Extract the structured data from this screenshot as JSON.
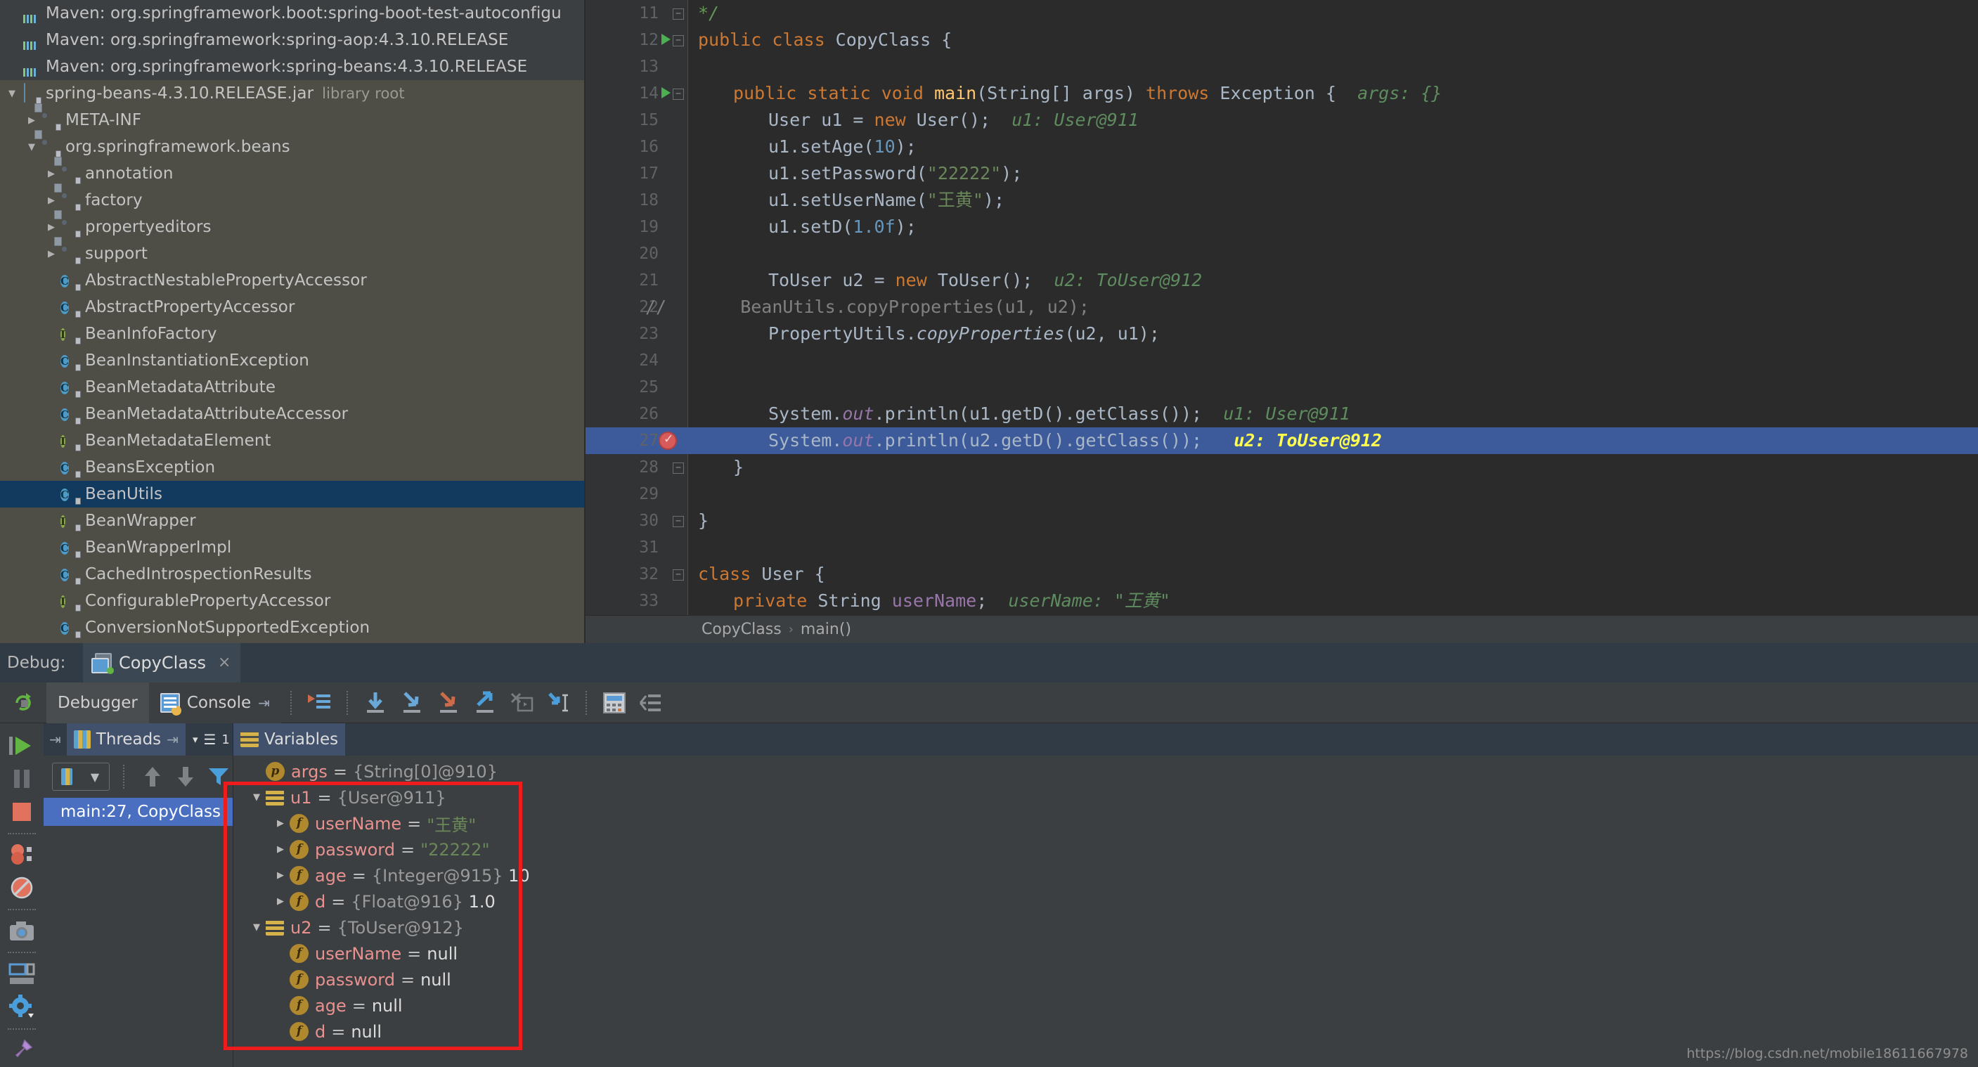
{
  "project_tree": {
    "items": [
      {
        "label": "Maven: org.springframework.boot:spring-boot-test-autoconfigu",
        "icon": "maven-icon",
        "indent": 0,
        "arrow": "none",
        "style": "maven"
      },
      {
        "label": "Maven: org.springframework:spring-aop:4.3.10.RELEASE",
        "icon": "maven-icon",
        "indent": 0,
        "arrow": "none",
        "style": "maven"
      },
      {
        "label": "Maven: org.springframework:spring-beans:4.3.10.RELEASE",
        "icon": "maven-icon",
        "indent": 0,
        "arrow": "none",
        "style": "maven"
      },
      {
        "label": "spring-beans-4.3.10.RELEASE.jar",
        "sub": "library root",
        "icon": "jar-icon",
        "indent": 0,
        "arrow": "down",
        "style": "normal"
      },
      {
        "label": "META-INF",
        "icon": "package-icon",
        "indent": 1,
        "arrow": "right",
        "style": "normal"
      },
      {
        "label": "org.springframework.beans",
        "icon": "package-icon",
        "indent": 1,
        "arrow": "down",
        "style": "normal"
      },
      {
        "label": "annotation",
        "icon": "package-icon",
        "indent": 2,
        "arrow": "right",
        "style": "normal"
      },
      {
        "label": "factory",
        "icon": "package-icon",
        "indent": 2,
        "arrow": "right",
        "style": "normal"
      },
      {
        "label": "propertyeditors",
        "icon": "package-icon",
        "indent": 2,
        "arrow": "right",
        "style": "normal"
      },
      {
        "label": "support",
        "icon": "package-icon",
        "indent": 2,
        "arrow": "right",
        "style": "normal"
      },
      {
        "label": "AbstractNestablePropertyAccessor",
        "icon": "class-icon",
        "indent": 2,
        "arrow": "none",
        "style": "normal"
      },
      {
        "label": "AbstractPropertyAccessor",
        "icon": "class-icon",
        "indent": 2,
        "arrow": "none",
        "style": "normal"
      },
      {
        "label": "BeanInfoFactory",
        "icon": "interface-icon",
        "indent": 2,
        "arrow": "none",
        "style": "normal"
      },
      {
        "label": "BeanInstantiationException",
        "icon": "class-icon",
        "indent": 2,
        "arrow": "none",
        "style": "normal"
      },
      {
        "label": "BeanMetadataAttribute",
        "icon": "class-icon",
        "indent": 2,
        "arrow": "none",
        "style": "normal"
      },
      {
        "label": "BeanMetadataAttributeAccessor",
        "icon": "class-icon",
        "indent": 2,
        "arrow": "none",
        "style": "normal"
      },
      {
        "label": "BeanMetadataElement",
        "icon": "interface-icon",
        "indent": 2,
        "arrow": "none",
        "style": "normal"
      },
      {
        "label": "BeansException",
        "icon": "class-icon",
        "indent": 2,
        "arrow": "none",
        "style": "normal"
      },
      {
        "label": "BeanUtils",
        "icon": "class-icon",
        "indent": 2,
        "arrow": "none",
        "style": "selected"
      },
      {
        "label": "BeanWrapper",
        "icon": "interface-icon",
        "indent": 2,
        "arrow": "none",
        "style": "normal"
      },
      {
        "label": "BeanWrapperImpl",
        "icon": "class-icon",
        "indent": 2,
        "arrow": "none",
        "style": "normal"
      },
      {
        "label": "CachedIntrospectionResults",
        "icon": "class-icon",
        "indent": 2,
        "arrow": "none",
        "style": "normal"
      },
      {
        "label": "ConfigurablePropertyAccessor",
        "icon": "interface-icon",
        "indent": 2,
        "arrow": "none",
        "style": "normal"
      },
      {
        "label": "ConversionNotSupportedException",
        "icon": "class-icon",
        "indent": 2,
        "arrow": "none",
        "style": "normal"
      }
    ]
  },
  "editor": {
    "first_line": 11,
    "highlighted_line": 27,
    "breakpoint_line": 27,
    "run_marker_lines": [
      12,
      14
    ],
    "lines": [
      {
        "n": 11,
        "indent": 0,
        "tokens": [
          {
            "t": "*/",
            "c": "cmg"
          }
        ]
      },
      {
        "n": 12,
        "indent": 0,
        "tokens": [
          {
            "t": "public class ",
            "c": "kw"
          },
          {
            "t": "CopyClass {",
            "c": "white"
          }
        ]
      },
      {
        "n": 13,
        "indent": 0,
        "tokens": []
      },
      {
        "n": 14,
        "indent": 1,
        "tokens": [
          {
            "t": "public static void ",
            "c": "kw"
          },
          {
            "t": "main",
            "c": "fn"
          },
          {
            "t": "(String[] args) ",
            "c": "white"
          },
          {
            "t": "throws ",
            "c": "kw"
          },
          {
            "t": "Exception {",
            "c": "white"
          },
          {
            "t": "  args: {}",
            "c": "hint"
          }
        ]
      },
      {
        "n": 15,
        "indent": 2,
        "tokens": [
          {
            "t": "User u1 = ",
            "c": "white"
          },
          {
            "t": "new ",
            "c": "kw"
          },
          {
            "t": "User();",
            "c": "white"
          },
          {
            "t": "  u1: User@911",
            "c": "hint"
          }
        ]
      },
      {
        "n": 16,
        "indent": 2,
        "tokens": [
          {
            "t": "u1.setAge(",
            "c": "white"
          },
          {
            "t": "10",
            "c": "num"
          },
          {
            "t": ");",
            "c": "white"
          }
        ]
      },
      {
        "n": 17,
        "indent": 2,
        "tokens": [
          {
            "t": "u1.setPassword(",
            "c": "white"
          },
          {
            "t": "\"22222\"",
            "c": "str"
          },
          {
            "t": ");",
            "c": "white"
          }
        ]
      },
      {
        "n": 18,
        "indent": 2,
        "tokens": [
          {
            "t": "u1.setUserName(",
            "c": "white"
          },
          {
            "t": "\"王黄\"",
            "c": "str"
          },
          {
            "t": ");",
            "c": "white"
          }
        ]
      },
      {
        "n": 19,
        "indent": 2,
        "tokens": [
          {
            "t": "u1.setD(",
            "c": "white"
          },
          {
            "t": "1.0f",
            "c": "num"
          },
          {
            "t": ");",
            "c": "white"
          }
        ]
      },
      {
        "n": 20,
        "indent": 0,
        "tokens": []
      },
      {
        "n": 21,
        "indent": 2,
        "tokens": [
          {
            "t": "ToUser u2 = ",
            "c": "white"
          },
          {
            "t": "new ",
            "c": "kw"
          },
          {
            "t": "ToUser();",
            "c": "white"
          },
          {
            "t": "  u2: ToUser@912",
            "c": "hint"
          }
        ]
      },
      {
        "n": 22,
        "indent": 0,
        "comment_prefix": "//",
        "tokens": [
          {
            "t": "    BeanUtils.copyProperties(u1, u2);",
            "c": "cm"
          }
        ]
      },
      {
        "n": 23,
        "indent": 2,
        "tokens": [
          {
            "t": "PropertyUtils.",
            "c": "white"
          },
          {
            "t": "copyProperties",
            "c": "ital"
          },
          {
            "t": "(u2, u1);",
            "c": "white"
          }
        ]
      },
      {
        "n": 24,
        "indent": 0,
        "tokens": []
      },
      {
        "n": 25,
        "indent": 0,
        "tokens": []
      },
      {
        "n": 26,
        "indent": 2,
        "tokens": [
          {
            "t": "System.",
            "c": "white"
          },
          {
            "t": "out",
            "c": "fld"
          },
          {
            "t": ".println(u1.getD().getClass());",
            "c": "white"
          },
          {
            "t": "  u1: User@911",
            "c": "hint"
          }
        ]
      },
      {
        "n": 27,
        "indent": 2,
        "tokens": [
          {
            "t": "System.",
            "c": "white"
          },
          {
            "t": "out",
            "c": "fld"
          },
          {
            "t": ".println(u2.getD().getClass());",
            "c": "white"
          },
          {
            "t": "   u2: ToUser@912",
            "c": "hint-hl"
          }
        ]
      },
      {
        "n": 28,
        "indent": 1,
        "tokens": [
          {
            "t": "}",
            "c": "white"
          }
        ]
      },
      {
        "n": 29,
        "indent": 0,
        "tokens": []
      },
      {
        "n": 30,
        "indent": 0,
        "tokens": [
          {
            "t": "}",
            "c": "white"
          }
        ]
      },
      {
        "n": 31,
        "indent": 0,
        "tokens": []
      },
      {
        "n": 32,
        "indent": 0,
        "tokens": [
          {
            "t": "class ",
            "c": "kw"
          },
          {
            "t": "User {",
            "c": "white"
          }
        ]
      },
      {
        "n": 33,
        "indent": 1,
        "tokens": [
          {
            "t": "private ",
            "c": "kw"
          },
          {
            "t": "String ",
            "c": "white"
          },
          {
            "t": "userName",
            "c": "fldp"
          },
          {
            "t": ";",
            "c": "white"
          },
          {
            "t": "  userName: \"王黄\"",
            "c": "hint"
          }
        ]
      }
    ],
    "breadcrumb": {
      "class": "CopyClass",
      "separator": "›",
      "method": "main()"
    }
  },
  "debug": {
    "label": "Debug:",
    "session_tab": "CopyClass",
    "close_glyph": "×",
    "rerun_title": "Rerun",
    "tabs": [
      {
        "label": "Debugger",
        "active": true,
        "icon": "debugger-icon"
      },
      {
        "label": "Console",
        "active": false,
        "icon": "console-icon"
      }
    ],
    "pin_glyph": "⇥",
    "toolbar_buttons": [
      {
        "name": "show-execution-point-icon"
      },
      {
        "name": "step-over-icon"
      },
      {
        "name": "step-into-icon"
      },
      {
        "name": "force-step-into-icon"
      },
      {
        "name": "step-out-icon"
      },
      {
        "name": "drop-frame-icon"
      },
      {
        "name": "run-to-cursor-icon"
      },
      {
        "name": "evaluate-expression-icon"
      },
      {
        "name": "mute-breakpoints-icon"
      }
    ],
    "rail_buttons": [
      {
        "name": "resume-program-icon"
      },
      {
        "name": "pause-program-icon"
      },
      {
        "name": "stop-icon"
      },
      {
        "name": "view-breakpoints-icon"
      },
      {
        "name": "mute-breakpoints-icon"
      },
      {
        "name": "get-thread-dump-icon"
      },
      {
        "name": "restore-layout-icon"
      },
      {
        "name": "settings-icon"
      },
      {
        "name": "pin-tab-icon"
      }
    ],
    "threads_panel": {
      "tab_label": "Threads",
      "pin_glyph": "⇥",
      "count": "1",
      "items": [
        {
          "label": "main:27, CopyClass",
          "selected": true
        }
      ]
    },
    "variables_panel": {
      "tab_label": "Variables",
      "rows": [
        {
          "tri": "none",
          "badge": "p",
          "name": "args",
          "eq": "=",
          "value": "{String[0]@910}",
          "value_kind": "obj",
          "indent": 0
        },
        {
          "tri": "down",
          "badge": "obj",
          "name": "u1",
          "eq": "=",
          "value": "{User@911}",
          "value_kind": "obj",
          "indent": 0
        },
        {
          "tri": "right",
          "badge": "f",
          "name": "userName",
          "eq": "=",
          "value": "\"王黄\"",
          "value_kind": "str",
          "indent": 1
        },
        {
          "tri": "right",
          "badge": "f",
          "name": "password",
          "eq": "=",
          "value": "\"22222\"",
          "value_kind": "str",
          "indent": 1
        },
        {
          "tri": "right",
          "badge": "f",
          "name": "age",
          "eq": "=",
          "value": "{Integer@915}",
          "value_kind": "obj",
          "indent": 1,
          "extra": "10"
        },
        {
          "tri": "right",
          "badge": "f",
          "name": "d",
          "eq": "=",
          "value": "{Float@916}",
          "value_kind": "obj",
          "indent": 1,
          "extra": "1.0"
        },
        {
          "tri": "down",
          "badge": "obj",
          "name": "u2",
          "eq": "=",
          "value": "{ToUser@912}",
          "value_kind": "obj",
          "indent": 0
        },
        {
          "tri": "none",
          "badge": "f",
          "name": "userName",
          "eq": "=",
          "value": "null",
          "value_kind": "null",
          "indent": 1
        },
        {
          "tri": "none",
          "badge": "f",
          "name": "password",
          "eq": "=",
          "value": "null",
          "value_kind": "null",
          "indent": 1
        },
        {
          "tri": "none",
          "badge": "f",
          "name": "age",
          "eq": "=",
          "value": "null",
          "value_kind": "null",
          "indent": 1
        },
        {
          "tri": "none",
          "badge": "f",
          "name": "d",
          "eq": "=",
          "value": "null",
          "value_kind": "null",
          "indent": 1
        }
      ]
    }
  },
  "annotation": {
    "highlight_color": "#ee1c1c"
  },
  "watermark": {
    "text": "https://blog.csdn.net/mobile18611667978"
  }
}
